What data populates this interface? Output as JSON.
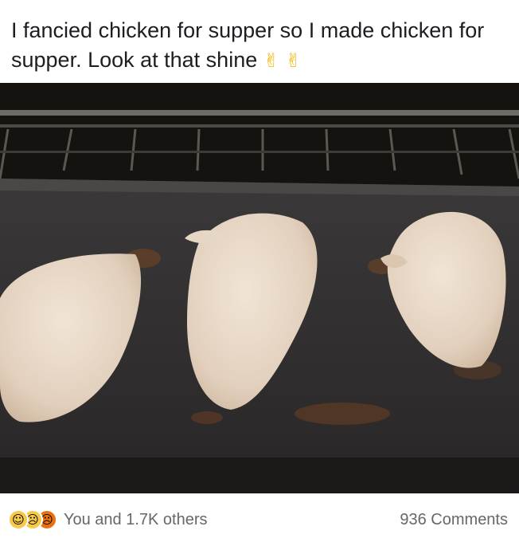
{
  "post": {
    "caption": "I fancied chicken for supper so I made chicken for supper. Look at that shine",
    "caption_emojis": [
      "ok-hand-emoji",
      "ok-hand-emoji"
    ]
  },
  "photo": {
    "description_icon": "photo"
  },
  "footer": {
    "reactions": [
      "haha",
      "sad",
      "angry"
    ],
    "reaction_count": "You and 1.7K others",
    "comments": "936 Comments"
  },
  "colors": {
    "text": "#1c1e21",
    "muted": "#65676b",
    "reaction_yellow": "#f7c948",
    "reaction_orange": "#e9710f"
  }
}
